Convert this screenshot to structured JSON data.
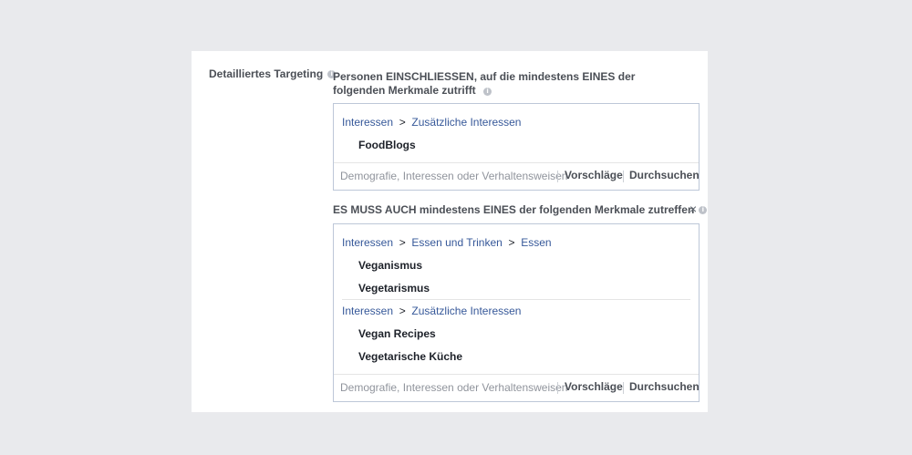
{
  "section_label": "Detailliertes Targeting",
  "include": {
    "title": "Personen EINSCHLIESSEN, auf die mindestens EINES der folgenden Merkmale zutrifft",
    "groups": [
      {
        "path": [
          "Interessen",
          "Zusätzliche Interessen"
        ],
        "items": [
          "FoodBlogs"
        ]
      }
    ],
    "input_placeholder": "Demografie, Interessen oder Verhaltensweisen",
    "suggestions_label": "Vorschläge",
    "browse_label": "Durchsuchen"
  },
  "narrow": {
    "title": "ES MUSS AUCH mindestens EINES der folgenden Merkmale zutreffen",
    "groups": [
      {
        "path": [
          "Interessen",
          "Essen und Trinken",
          "Essen"
        ],
        "items": [
          "Veganismus",
          "Vegetarismus"
        ]
      },
      {
        "path": [
          "Interessen",
          "Zusätzliche Interessen"
        ],
        "items": [
          "Vegan Recipes",
          "Vegetarische Küche"
        ]
      }
    ],
    "input_placeholder": "Demografie, Interessen oder Verhaltensweisen",
    "suggestions_label": "Vorschläge",
    "browse_label": "Durchsuchen",
    "close_symbol": "×"
  },
  "info_symbol": "i",
  "path_separator": ">",
  "colors": {
    "link": "#365899",
    "background": "#e9eaed",
    "border": "#bdc7d8"
  }
}
